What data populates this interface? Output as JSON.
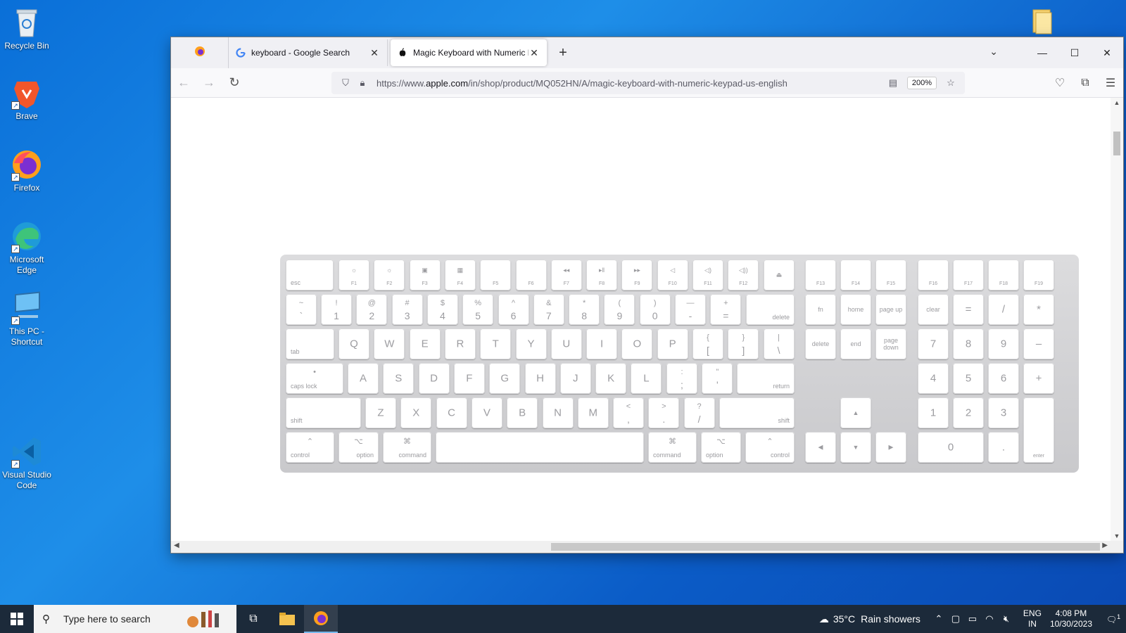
{
  "desktop": {
    "icons": [
      {
        "label": "Recycle Bin"
      },
      {
        "label": "Brave"
      },
      {
        "label": "Firefox"
      },
      {
        "label": "Microsoft Edge"
      },
      {
        "label": "This PC - Shortcut"
      },
      {
        "label": "Visual Studio Code"
      }
    ]
  },
  "browser": {
    "tabs": [
      {
        "label": "keyboard - Google Search",
        "favicon": "google-icon"
      },
      {
        "label": "Magic Keyboard with Numeric Keypad",
        "favicon": "apple-icon"
      }
    ],
    "url_prefix": "https://www.",
    "url_domain": "apple.com",
    "url_path": "/in/shop/product/MQ052HN/A/magic-keyboard-with-numeric-keypad-us-english",
    "zoom": "200%"
  },
  "keyboard": {
    "fn_row": [
      "esc",
      "F1",
      "F2",
      "F3",
      "F4",
      "F5",
      "F6",
      "F7",
      "F8",
      "F9",
      "F10",
      "F11",
      "F12"
    ],
    "fn_right": [
      "F13",
      "F14",
      "F15",
      "F16",
      "F17",
      "F18",
      "F19"
    ],
    "num_row": [
      [
        "~",
        "`"
      ],
      [
        "!",
        "1"
      ],
      [
        "@",
        "2"
      ],
      [
        "#",
        "3"
      ],
      [
        "$",
        "4"
      ],
      [
        "%",
        "5"
      ],
      [
        "^",
        "6"
      ],
      [
        "&",
        "7"
      ],
      [
        "*",
        "8"
      ],
      [
        "(",
        "9"
      ],
      [
        ")",
        "0"
      ],
      [
        "—",
        "-"
      ],
      [
        "+",
        "="
      ]
    ],
    "delete": "delete",
    "tab": "tab",
    "qrow": [
      "Q",
      "W",
      "E",
      "R",
      "T",
      "Y",
      "U",
      "I",
      "O",
      "P"
    ],
    "qrow_sym": [
      [
        "{",
        "["
      ],
      [
        "}",
        "]"
      ],
      [
        "|",
        "\\"
      ]
    ],
    "caps": "caps lock",
    "arow": [
      "A",
      "S",
      "D",
      "F",
      "G",
      "H",
      "J",
      "K",
      "L"
    ],
    "arow_sym": [
      [
        ":",
        ";"
      ],
      [
        "\"",
        "'"
      ]
    ],
    "return": "return",
    "shift": "shift",
    "zrow": [
      "Z",
      "X",
      "C",
      "V",
      "B",
      "N",
      "M"
    ],
    "zrow_sym": [
      [
        "<",
        ","
      ],
      [
        ">",
        "."
      ],
      [
        "?",
        "/"
      ]
    ],
    "control": "control",
    "option": "option",
    "command": "command",
    "nav": {
      "fn": "fn",
      "home": "home",
      "page_up_1": "page",
      "page_up_2": "up",
      "delete": "delete",
      "end": "end",
      "page_down_1": "page",
      "page_down_2": "down"
    },
    "numpad": {
      "clear": "clear",
      "eq": "=",
      "div": "/",
      "mul": "*",
      "r1": [
        "7",
        "8",
        "9"
      ],
      "minus": "–",
      "r2": [
        "4",
        "5",
        "6"
      ],
      "plus": "+",
      "r3": [
        "1",
        "2",
        "3"
      ],
      "zero": "0",
      "dot": ".",
      "enter": "enter"
    }
  },
  "taskbar": {
    "search_placeholder": "Type here to search",
    "weather_temp": "35°C",
    "weather_text": "Rain showers",
    "lang_1": "ENG",
    "lang_2": "IN",
    "time": "4:08 PM",
    "date": "10/30/2023",
    "notif_count": "1"
  }
}
